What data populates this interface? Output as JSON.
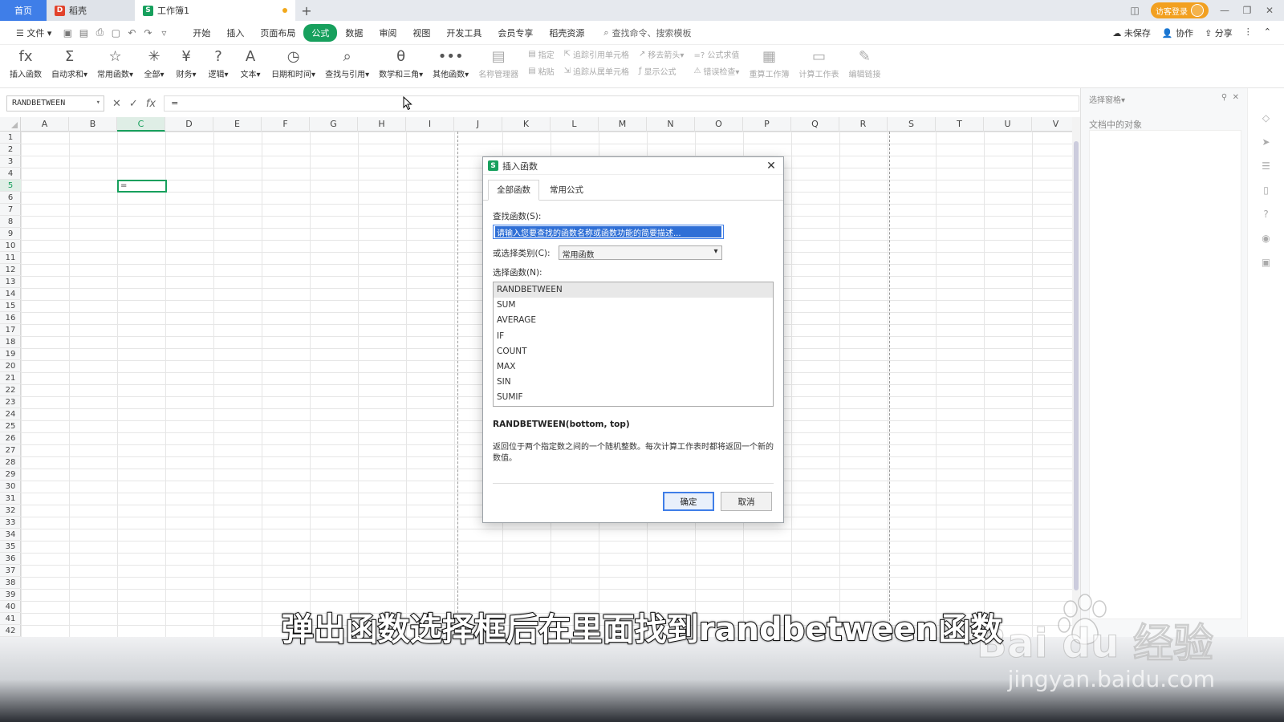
{
  "tabs": {
    "home": "首页",
    "draw": "稻壳",
    "workbook": "工作簿1",
    "login": "访客登录"
  },
  "menu": {
    "file": "文件",
    "items": [
      "开始",
      "插入",
      "页面布局",
      "公式",
      "数据",
      "审阅",
      "视图",
      "开发工具",
      "会员专享",
      "稻壳资源"
    ],
    "active_index": 3,
    "search": "查找命令、搜索模板",
    "unsaved": "未保存",
    "collab": "协作",
    "share": "分享"
  },
  "ribbon": {
    "big": [
      {
        "icon": "fx",
        "label": "插入函数"
      },
      {
        "icon": "Σ",
        "label": "自动求和▾"
      },
      {
        "icon": "☆",
        "label": "常用函数▾"
      },
      {
        "icon": "✳",
        "label": "全部▾"
      },
      {
        "icon": "¥",
        "label": "财务▾"
      },
      {
        "icon": "?",
        "label": "逻辑▾"
      },
      {
        "icon": "A",
        "label": "文本▾"
      },
      {
        "icon": "◷",
        "label": "日期和时间▾"
      },
      {
        "icon": "⌕",
        "label": "查找与引用▾"
      },
      {
        "icon": "θ",
        "label": "数学和三角▾"
      },
      {
        "icon": "•••",
        "label": "其他函数▾"
      },
      {
        "icon": "▤",
        "label": "名称管理器"
      }
    ],
    "small1": [
      "指定",
      "粘贴"
    ],
    "small2": [
      "追踪引用单元格",
      "追踪从属单元格"
    ],
    "small3": [
      "移去箭头▾",
      "显示公式"
    ],
    "small4": [
      "=? 公式求值",
      "错误检查▾"
    ],
    "big2": [
      {
        "icon": "▦",
        "label": "重算工作簿"
      },
      {
        "icon": "▭",
        "label": "计算工作表"
      },
      {
        "icon": "✎",
        "label": "编辑链接"
      }
    ]
  },
  "formula_bar": {
    "name_box": "RANDBETWEEN",
    "content": "="
  },
  "grid": {
    "columns": [
      "A",
      "B",
      "C",
      "D",
      "E",
      "F",
      "G",
      "H",
      "I",
      "J",
      "K",
      "L",
      "M",
      "N",
      "O",
      "P",
      "Q",
      "R",
      "S",
      "T",
      "U",
      "V"
    ],
    "selected_column": "C",
    "rows": 42,
    "selected_row": 5,
    "active_cell_value": "="
  },
  "right_pane": {
    "title": "选择窗格▾",
    "subtitle": "文档中的对象"
  },
  "dialog": {
    "title": "插入函数",
    "tabs": [
      "全部函数",
      "常用公式"
    ],
    "search_label": "查找函数(S):",
    "search_value": "请输入您要查找的函数名称或函数功能的简要描述...",
    "category_label": "或选择类别(C):",
    "category_value": "常用函数",
    "list_label": "选择函数(N):",
    "functions": [
      "RANDBETWEEN",
      "SUM",
      "AVERAGE",
      "IF",
      "COUNT",
      "MAX",
      "SIN",
      "SUMIF"
    ],
    "selected_function": 0,
    "signature": "RANDBETWEEN(bottom, top)",
    "description": "返回位于两个指定数之间的一个随机整数。每次计算工作表时都将返回一个新的数值。",
    "ok": "确定",
    "cancel": "取消"
  },
  "subtitle": "弹出函数选择框后在里面找到randbetween函数",
  "watermark": {
    "brand": "Bai du 经验",
    "url": "jingyan.baidu.com"
  }
}
